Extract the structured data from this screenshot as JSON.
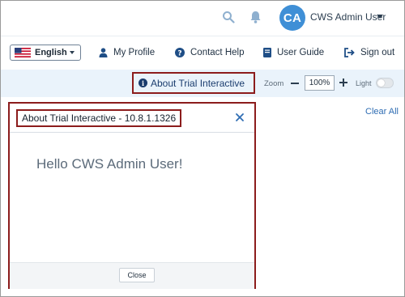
{
  "header": {
    "avatar_initials": "CA",
    "user_name": "CWS Admin User",
    "icons": [
      "search-icon",
      "bell-icon",
      "chevron-down-icon"
    ]
  },
  "nav": {
    "language": {
      "label": "English",
      "flag": "us-flag-icon"
    },
    "links": [
      {
        "label": "My Profile",
        "icon": "user-icon"
      },
      {
        "label": "Contact Help",
        "icon": "question-circle-icon"
      },
      {
        "label": "User Guide",
        "icon": "book-icon"
      },
      {
        "label": "Sign out",
        "icon": "sign-out-icon"
      }
    ]
  },
  "infobar": {
    "about_label": "About Trial Interactive",
    "zoom_label": "Zoom",
    "zoom_value": "100%",
    "light_label": "Light",
    "light_on": false
  },
  "content": {
    "clear_all_label": "Clear All"
  },
  "dialog": {
    "title": "About Trial Interactive - 10.8.1.1326",
    "greeting": "Hello CWS Admin User!",
    "close_button_label": "Close"
  },
  "colors": {
    "accent": "#3f8fd6",
    "highlight_border": "#8c1c1c",
    "infobar_bg": "#eaf3fb",
    "link": "#2f6db3"
  }
}
